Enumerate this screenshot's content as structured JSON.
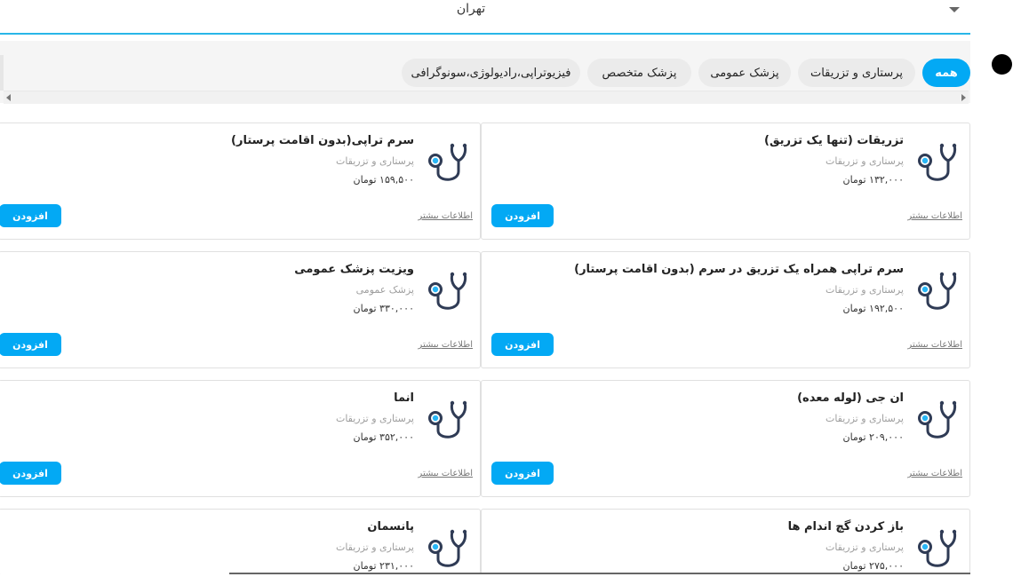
{
  "header": {
    "city": "تهران"
  },
  "filters": [
    {
      "label": "همه",
      "active": true
    },
    {
      "label": "پرستاری و تزریقات",
      "active": false
    },
    {
      "label": "پزشک عمومی",
      "active": false
    },
    {
      "label": "پزشک متخصص",
      "active": false
    },
    {
      "label": "فیزیوتراپی،رادیولوژی،سونوگرافی",
      "active": false
    }
  ],
  "card_actions": {
    "more": "اطلاعات بیشتر",
    "add": "افزودن"
  },
  "cards": [
    {
      "title": "تزریقات (تنها یک تزریق)",
      "category": "پرستاری و تزریقات",
      "price": "۱۳۲,۰۰۰ تومان"
    },
    {
      "title": "سرم تراپی(بدون اقامت پرستار)",
      "category": "پرستاری و تزریقات",
      "price": "۱۵۹,۵۰۰ تومان"
    },
    {
      "title": "سرم تراپی همراه یک تزریق در سرم (بدون اقامت پرستار)",
      "category": "پرستاری و تزریقات",
      "price": "۱۹۲,۵۰۰ تومان"
    },
    {
      "title": "ویزیت پزشک عمومی",
      "category": "پزشک عمومی",
      "price": "۳۳۰,۰۰۰ تومان"
    },
    {
      "title": "ان جی (لوله معده)",
      "category": "پرستاری و تزریقات",
      "price": "۲۰۹,۰۰۰ تومان"
    },
    {
      "title": "انما",
      "category": "پرستاری و تزریقات",
      "price": "۳۵۲,۰۰۰ تومان"
    },
    {
      "title": "باز کردن گچ اندام ها",
      "category": "پرستاری و تزریقات",
      "price": "۲۷۵,۰۰۰ تومان"
    },
    {
      "title": "پانسمان",
      "category": "پرستاری و تزریقات",
      "price": "۲۳۱,۰۰۰ تومان"
    }
  ],
  "colors": {
    "accent": "#03a9f4",
    "icon_stroke": "#2f3b55",
    "icon_dot": "#29b6f6"
  },
  "icons": {
    "service": "stethoscope-icon"
  }
}
